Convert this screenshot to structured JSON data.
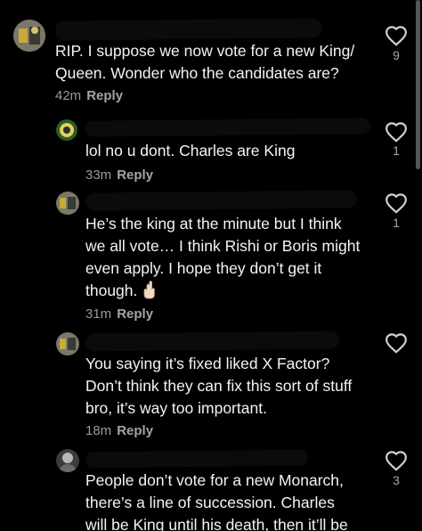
{
  "comments": [
    {
      "text_lines": [
        "RIP. I suppose we now vote for a new King/",
        "Queen. Wonder who the candidates are?"
      ],
      "time": "42m",
      "reply_label": "Reply",
      "likes": "9"
    },
    {
      "text_lines": [
        "lol no u dont. Charles are King"
      ],
      "time": "33m",
      "reply_label": "Reply",
      "likes": "1"
    },
    {
      "text_lines": [
        "He’s the king at the minute but I think",
        "we all vote… I think Rishi or Boris might",
        "even apply. I hope they don’t get it",
        "though."
      ],
      "time": "31m",
      "reply_label": "Reply",
      "likes": "1"
    },
    {
      "text_lines": [
        "You saying it’s fixed liked X Factor?",
        "Don’t think they can fix this sort of stuff",
        "bro, it’s way too important."
      ],
      "time": "18m",
      "reply_label": "Reply",
      "likes": ""
    },
    {
      "text_lines": [
        "People don’t vote for a new Monarch,",
        "there’s a line of succession. Charles",
        "will be King until his death, then it’ll be"
      ],
      "time": "",
      "reply_label": "",
      "likes": "3"
    }
  ],
  "icons": {
    "like": "heart-outline-icon",
    "emoji": "crossed-fingers-emoji"
  },
  "colors": {
    "background": "#000000",
    "text": "#f4f4f4",
    "meta": "#9a9a9a"
  }
}
